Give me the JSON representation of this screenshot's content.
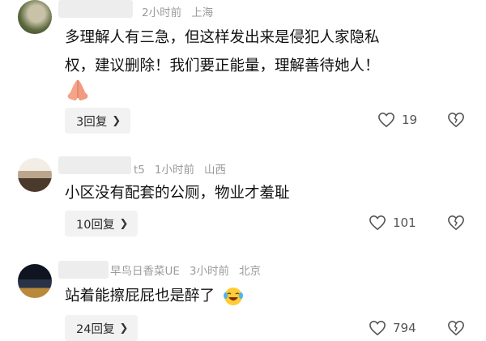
{
  "comments": [
    {
      "username": "",
      "time": "2小时前",
      "location": "上海",
      "text_line1": "多理解人有三急，但这样发出来是侵犯人家隐私",
      "text_line2": "权，建议删除！我们要正能量，理解善待她人！",
      "emoji": "praying-hands",
      "replies": "3回复",
      "likes": "19"
    },
    {
      "username": "t5",
      "time": "1小时前",
      "location": "山西",
      "text": "小区没有配套的公厕，物业才羞耻",
      "replies": "10回复",
      "likes": "101"
    },
    {
      "username": "早鸟日香菜UE",
      "time": "3小时前",
      "location": "北京",
      "text": "站着能擦屁屁也是醉了",
      "emoji": "laughing-crying-face",
      "replies": "24回复",
      "likes": "794"
    }
  ],
  "colors": {
    "meta": "#9b9b9b",
    "reply_bg": "#f2f2f2",
    "text": "#111111"
  }
}
